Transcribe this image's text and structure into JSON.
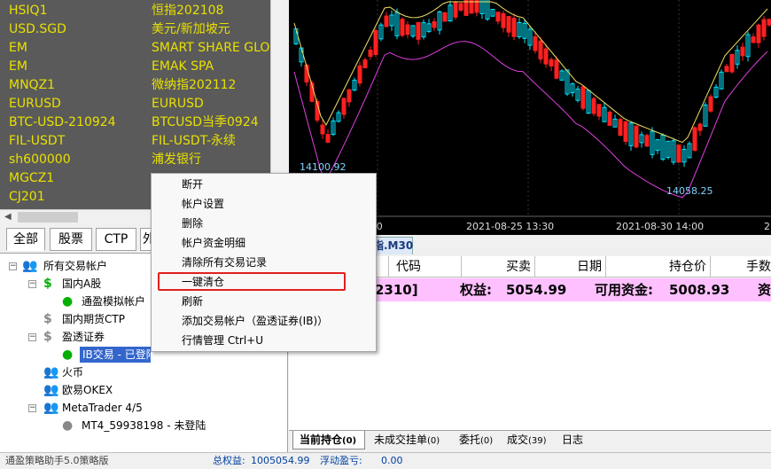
{
  "quotes": [
    {
      "symbol": "HSIQ1",
      "name": "恒指202108"
    },
    {
      "symbol": "USD.SGD",
      "name": "美元/新加坡元"
    },
    {
      "symbol": "EM",
      "name": "SMART SHARE GLO"
    },
    {
      "symbol": "EM",
      "name": "EMAK SPA"
    },
    {
      "symbol": "MNQZ1",
      "name": "微纳指202112"
    },
    {
      "symbol": "EURUSD",
      "name": "EURUSD"
    },
    {
      "symbol": "BTC-USD-210924",
      "name": "BTCUSD当季0924"
    },
    {
      "symbol": "FIL-USDT",
      "name": "FIL-USDT-永续"
    },
    {
      "symbol": "sh600000",
      "name": "浦发银行"
    },
    {
      "symbol": "MGCZ1",
      "name": ""
    },
    {
      "symbol": "CJ201",
      "name": ""
    }
  ],
  "left_tabs": [
    "全部",
    "股票",
    "CTP",
    "外"
  ],
  "tree": {
    "root": "所有交易帐户",
    "cn_a": "国内A股",
    "cn_a_child": "通盈模拟帐户",
    "ctp": "国内期货CTP",
    "ib": "盈透证券",
    "ib_child": "IB交易 - 已登陆",
    "huobi": "火币",
    "okex": "欧易OKEX",
    "mt": "MetaTrader 4/5",
    "mt_child": "MT4_59938198 - 未登陆"
  },
  "chart": {
    "price_low_label": "14100.92",
    "price_low2_label": "14058.25",
    "time_labels": [
      ":00",
      "2021-08-25 13:30",
      "2021-08-30 14:00",
      "2"
    ],
    "tab_label": "指.M30"
  },
  "grid": {
    "headers": [
      "代码",
      "买卖",
      "日期",
      "持仓价",
      "手数"
    ],
    "summary_left": "2310]",
    "equity_label": "权益:",
    "equity_value": "5054.99",
    "available_label": "可用资金:",
    "available_value": "5008.93",
    "cut": "资"
  },
  "bottom_tabs": [
    {
      "label": "当前持仓",
      "count": "(0)"
    },
    {
      "label": "未成交挂单",
      "count": "(0)"
    },
    {
      "label": "委托",
      "count": "(0)"
    },
    {
      "label": "成交",
      "count": "(39)"
    },
    {
      "label": "日志",
      "count": ""
    }
  ],
  "status": {
    "app": "通盈策略助手5.0策略版",
    "equity_label": "总权益:",
    "equity_value": "1005054.99",
    "float_label": "浮动盈亏:",
    "float_value": "0.00"
  },
  "menu": {
    "items": [
      "断开",
      "帐户设置",
      "删除",
      "帐户资金明细",
      "清除所有交易记录",
      "一键清仓",
      "刷新",
      "添加交易帐户（盈透证券(IB)）",
      "行情管理 Ctrl+U"
    ]
  },
  "colors": {
    "quote_text": "#e8e000",
    "quote_bg": "#5a5a5a",
    "candle_up": "#00e5ff",
    "candle_down": "#ff2020",
    "band": "#e040e0",
    "ma": "#f0e060",
    "summary_bg": "#ffc0ff",
    "highlight_border": "#e0201c"
  }
}
